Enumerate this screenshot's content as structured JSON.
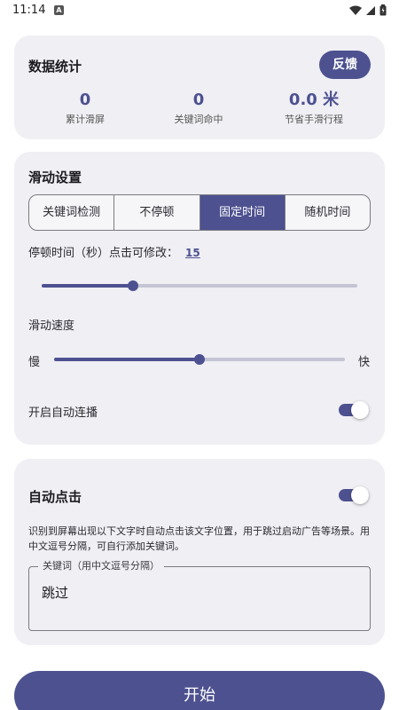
{
  "status_bar": {
    "time": "11:14",
    "notification_icon": "A"
  },
  "stats": {
    "title": "数据统计",
    "feedback_label": "反馈",
    "items": [
      {
        "value": "0",
        "label": "累计滑屏"
      },
      {
        "value": "0",
        "label": "关键词命中"
      },
      {
        "value": "0.0 米",
        "label": "节省手滑行程"
      }
    ]
  },
  "scroll_settings": {
    "title": "滑动设置",
    "modes": [
      "关键词检测",
      "不停顿",
      "固定时间",
      "随机时间"
    ],
    "selected_mode": "固定时间",
    "pause_label": "停顿时间（秒）点击可修改：",
    "pause_value": "15",
    "pause_slider_level": 0.29,
    "speed_label": "滑动速度",
    "speed_slow": "慢",
    "speed_fast": "快",
    "speed_slider_level": 0.5,
    "autoplay_label": "开启自动连播",
    "autoplay_on": true
  },
  "auto_click": {
    "title": "自动点击",
    "enabled": true,
    "description": "识别到屏幕出现以下文字时自动点击该文字位置，用于跳过启动广告等场景。用中文逗号分隔，可自行添加关键词。",
    "keyword_legend": "关键词（用中文逗号分隔）",
    "keyword_value": "跳过"
  },
  "start_label": "开始",
  "colors": {
    "accent": "#4d5190",
    "card_bg": "#efeff4",
    "track_inactive": "#c4c5d4"
  }
}
